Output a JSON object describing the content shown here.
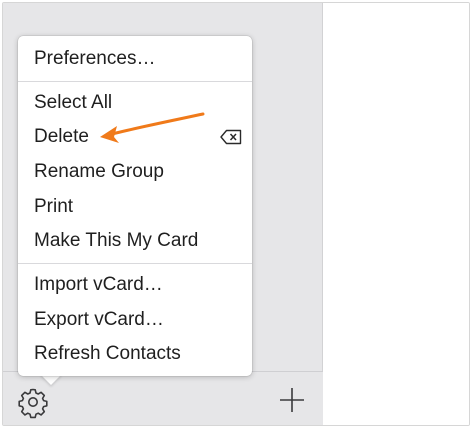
{
  "menu": {
    "items": [
      {
        "label": "Preferences…"
      },
      {
        "label": "Select All"
      },
      {
        "label": "Delete",
        "shortcut_icon": "delete-key-icon"
      },
      {
        "label": "Rename Group"
      },
      {
        "label": "Print"
      },
      {
        "label": "Make This My Card"
      },
      {
        "label": "Import vCard…"
      },
      {
        "label": "Export vCard…"
      },
      {
        "label": "Refresh Contacts"
      }
    ]
  },
  "toolbar": {
    "gear_icon": "gear-icon",
    "add_icon": "plus-icon"
  },
  "annotation": {
    "arrow_color": "#f07a1a"
  },
  "colors": {
    "sidebar_bg": "#e6e6e8",
    "menu_bg": "#ffffff",
    "text": "#1f1f1f"
  }
}
